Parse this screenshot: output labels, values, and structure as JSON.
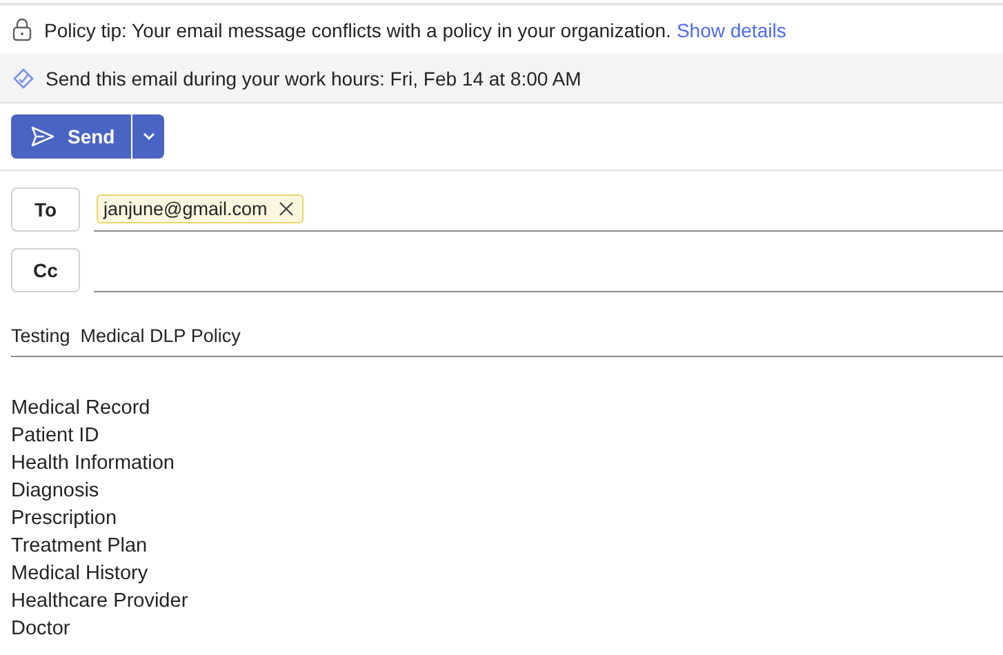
{
  "policy_tip": {
    "text": "Policy tip: Your email message conflicts with a policy in your organization.",
    "link": "Show details"
  },
  "schedule_tip": {
    "text": "Send this email during your work hours: Fri, Feb 14 at 8:00 AM"
  },
  "send_button": {
    "label": "Send"
  },
  "recipients": [
    {
      "label": "To",
      "chips": [
        "janjune@gmail.com"
      ]
    },
    {
      "label": "Cc"
    }
  ],
  "subject": "Testing  Medical DLP Policy",
  "body_lines": [
    "Medical Record",
    "Patient ID",
    "Health Information",
    "Diagnosis",
    "Prescription",
    "Treatment Plan",
    "Medical History",
    "Healthcare Provider",
    "Doctor"
  ]
}
